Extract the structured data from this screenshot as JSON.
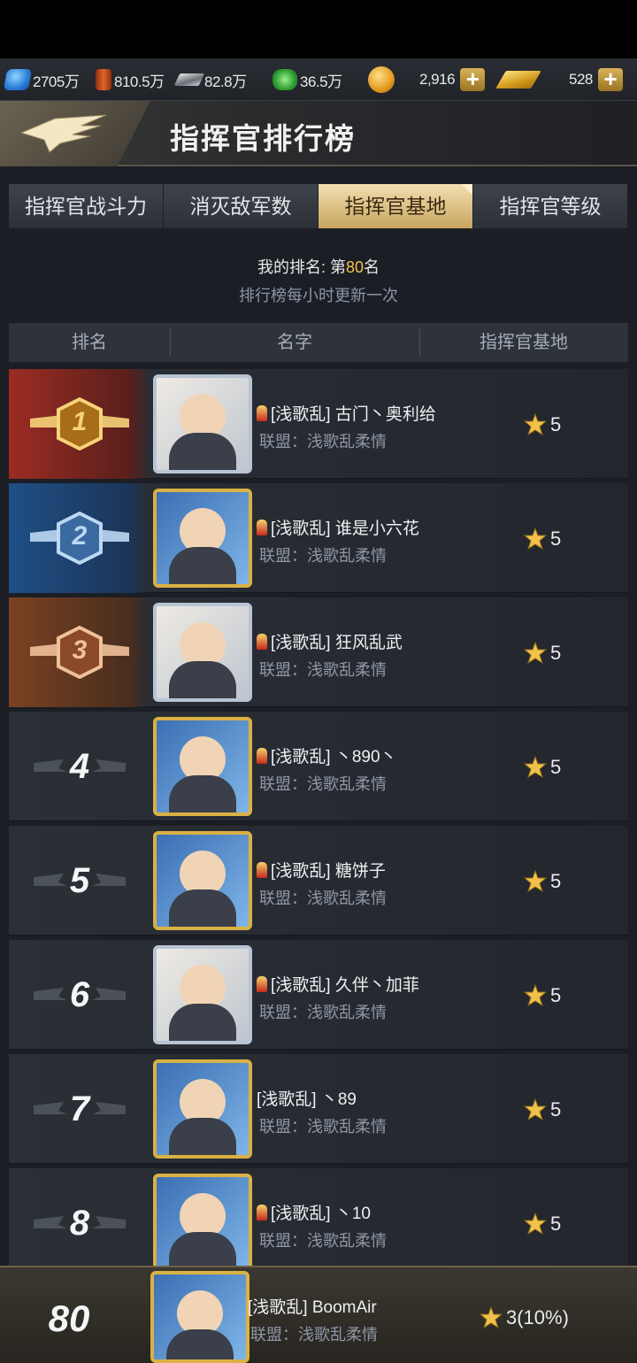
{
  "resources": {
    "crystal": "2705万",
    "oil": "810.5万",
    "steel": "82.8万",
    "cash": "36.5万",
    "coin": "2,916",
    "gold": "528"
  },
  "header": {
    "title": "指挥官排行榜"
  },
  "tabs": [
    {
      "label": "指挥官战斗力",
      "active": false
    },
    {
      "label": "消灭敌军数",
      "active": false
    },
    {
      "label": "指挥官基地",
      "active": true
    },
    {
      "label": "指挥官等级",
      "active": false
    }
  ],
  "my_rank": {
    "prefix": "我的排名: 第",
    "number": "80",
    "suffix": "名"
  },
  "update_note": "排行榜每小时更新一次",
  "columns": [
    "排名",
    "名字",
    "指挥官基地"
  ],
  "rows": [
    {
      "rank": "1",
      "name": "[浅歌乱] 古门丶奥利给",
      "alliance": "联盟：浅歌乱柔情",
      "base": "5"
    },
    {
      "rank": "2",
      "name": "[浅歌乱] 谁是小六花",
      "alliance": "联盟：浅歌乱柔情",
      "base": "5"
    },
    {
      "rank": "3",
      "name": "[浅歌乱] 狂风乱武",
      "alliance": "联盟：浅歌乱柔情",
      "base": "5"
    },
    {
      "rank": "4",
      "name": "[浅歌乱] 丶890丶",
      "alliance": "联盟：浅歌乱柔情",
      "base": "5"
    },
    {
      "rank": "5",
      "name": "[浅歌乱] 糖饼子",
      "alliance": "联盟：浅歌乱柔情",
      "base": "5"
    },
    {
      "rank": "6",
      "name": "[浅歌乱] 久伴丶加菲",
      "alliance": "联盟：浅歌乱柔情",
      "base": "5"
    },
    {
      "rank": "7",
      "name": "[浅歌乱] 丶89",
      "alliance": "联盟：浅歌乱柔情",
      "base": "5"
    },
    {
      "rank": "8",
      "name": "[浅歌乱] 丶10",
      "alliance": "联盟：浅歌乱柔情",
      "base": "5"
    }
  ],
  "me": {
    "rank": "80",
    "name": "[浅歌乱] BoomAir",
    "alliance": "联盟：浅歌乱柔情",
    "base": "3(10%)"
  },
  "colors": {
    "accent_gold": "#f2c14a",
    "tab_active": "#d8b46a",
    "rank1": "#9b2c23",
    "rank2": "#1f4f86",
    "rank3": "#7a4222"
  }
}
